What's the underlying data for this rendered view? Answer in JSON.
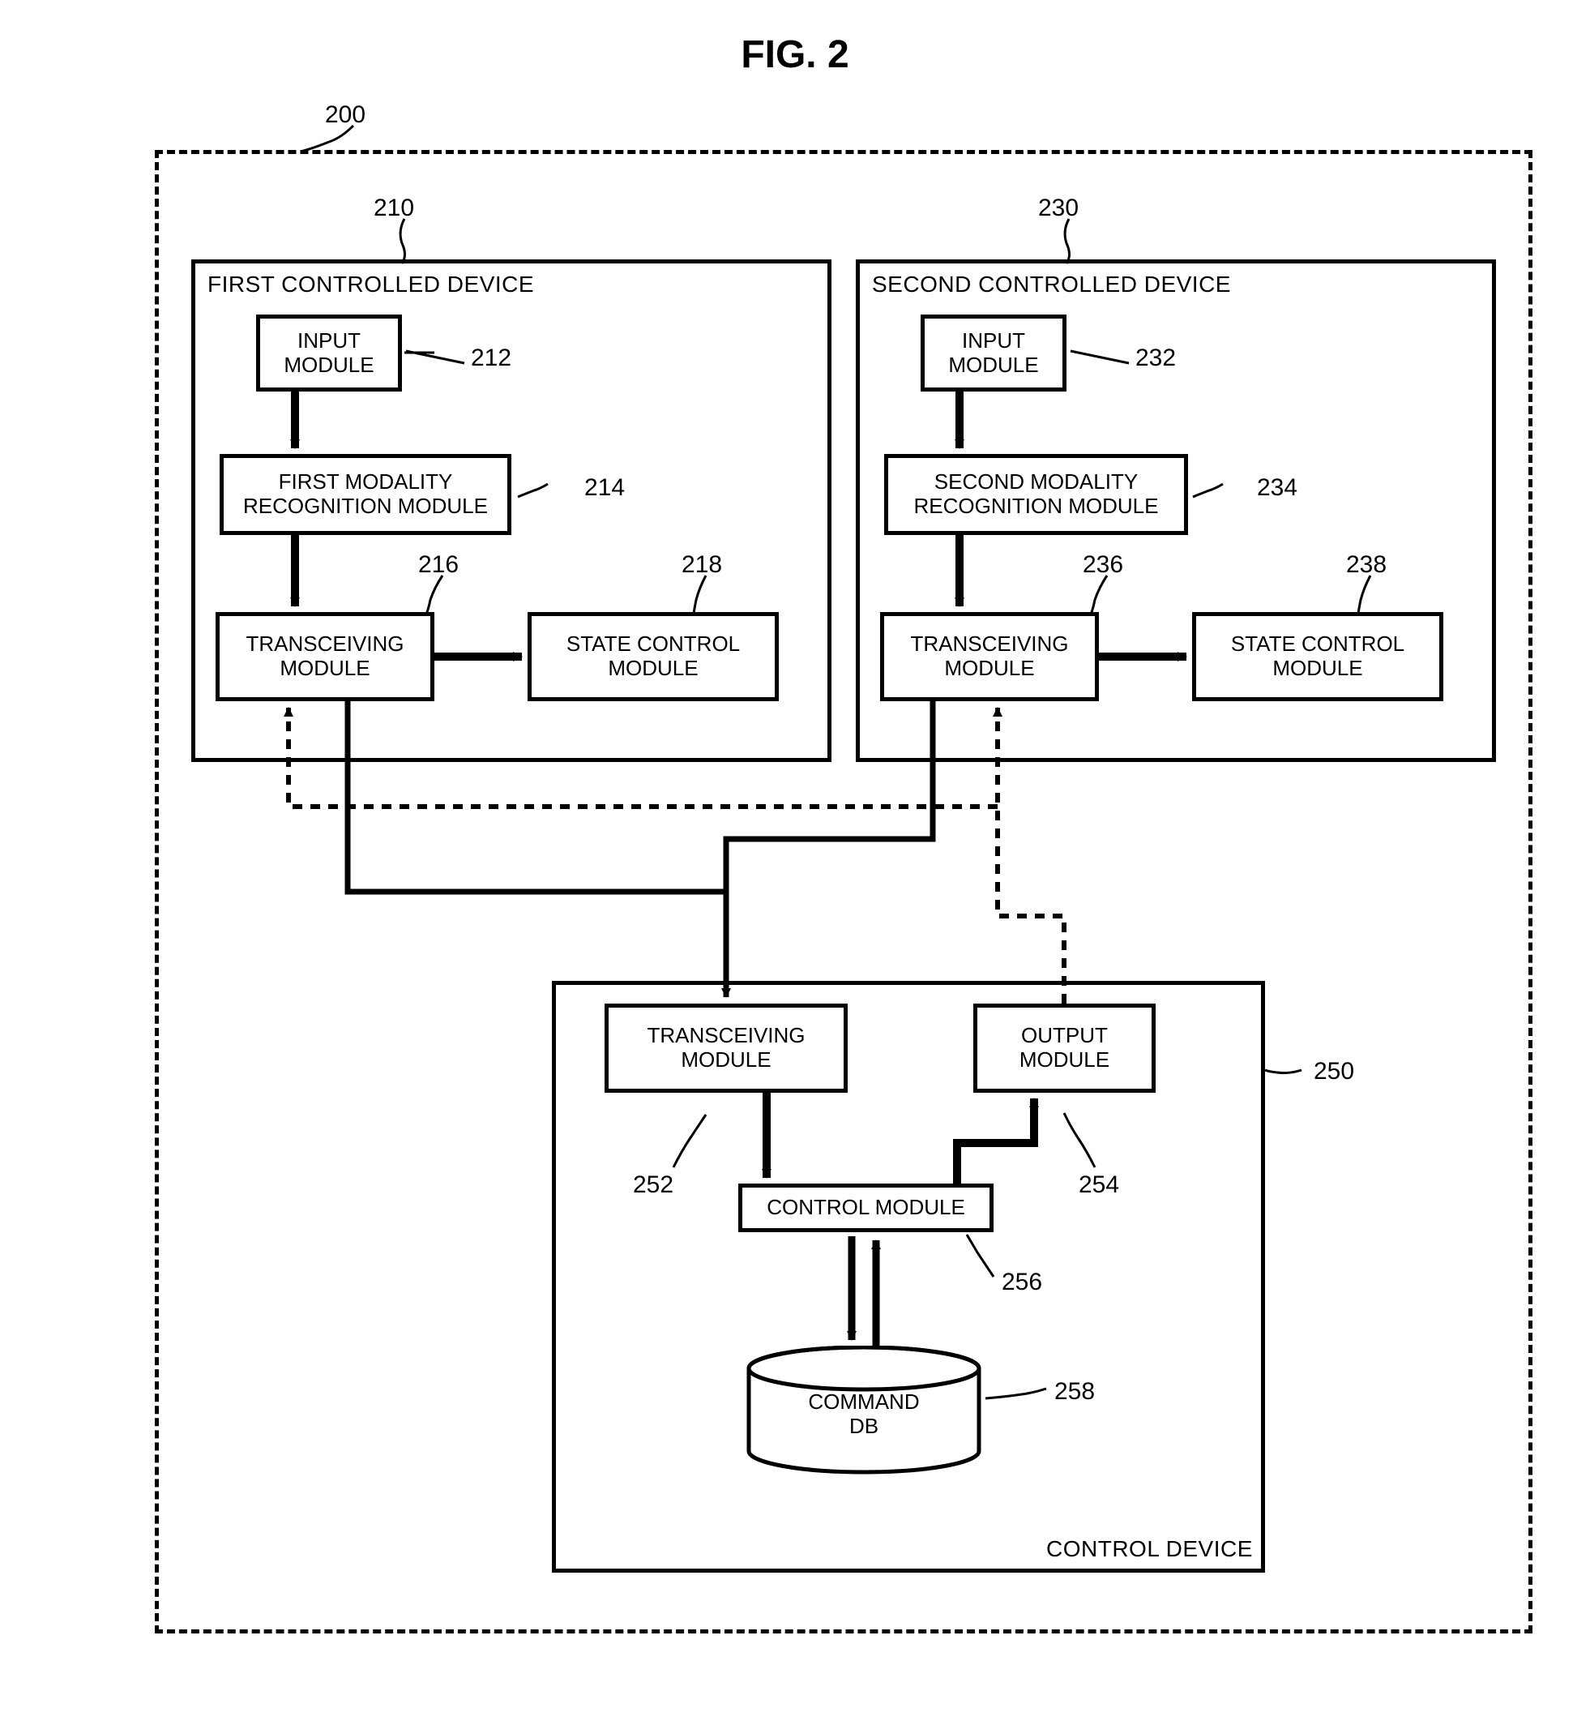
{
  "title": "FIG. 2",
  "outer_ref": "200",
  "device1": {
    "title": "FIRST CONTROLLED DEVICE",
    "ref": "210",
    "input": "INPUT\nMODULE",
    "input_ref": "212",
    "modality": "FIRST MODALITY\nRECOGNITION MODULE",
    "modality_ref": "214",
    "transceiving": "TRANSCEIVING\nMODULE",
    "transceiving_ref": "216",
    "state": "STATE CONTROL\nMODULE",
    "state_ref": "218"
  },
  "device2": {
    "title": "SECOND CONTROLLED DEVICE",
    "ref": "230",
    "input": "INPUT\nMODULE",
    "input_ref": "232",
    "modality": "SECOND MODALITY\nRECOGNITION MODULE",
    "modality_ref": "234",
    "transceiving": "TRANSCEIVING\nMODULE",
    "transceiving_ref": "236",
    "state": "STATE CONTROL\nMODULE",
    "state_ref": "238"
  },
  "control": {
    "title": "CONTROL DEVICE",
    "ref": "250",
    "transceiving": "TRANSCEIVING\nMODULE",
    "transceiving_ref": "252",
    "output": "OUTPUT\nMODULE",
    "output_ref": "254",
    "controlmod": "CONTROL MODULE",
    "controlmod_ref": "256",
    "db": "COMMAND\nDB",
    "db_ref": "258"
  }
}
